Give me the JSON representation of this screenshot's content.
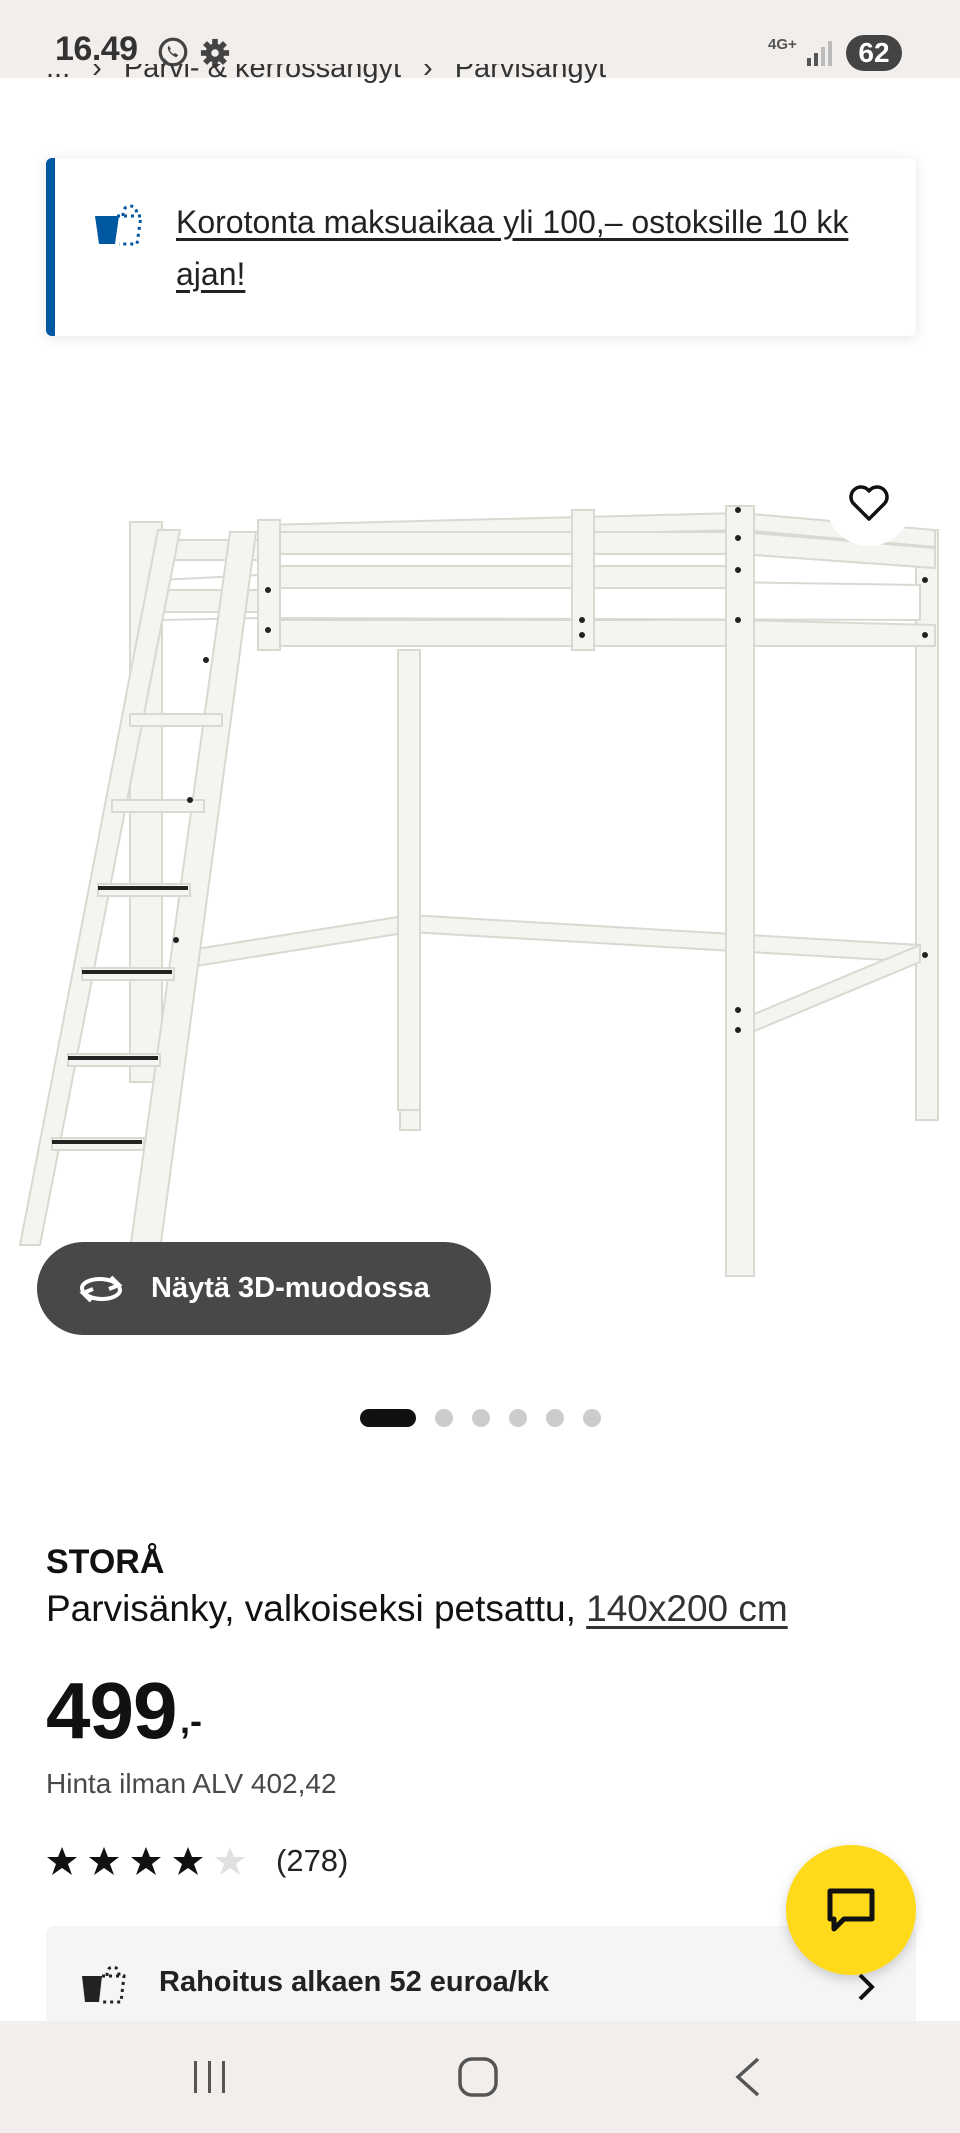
{
  "status_bar": {
    "time": "16.49",
    "network": "4G+",
    "battery": "62"
  },
  "breadcrumb": {
    "items": [
      "...",
      "Parvi- & kerrossängyt",
      "Parvisängyt"
    ],
    "separator": "›"
  },
  "promo": {
    "text": "Korotonta maksuaikaa yli 100,– ostoksille 10 kk ajan!"
  },
  "product": {
    "brand": "STORÅ",
    "description": "Parvisänky, valkoiseksi petsattu,",
    "size": "140x200 cm",
    "price": "499",
    "price_suffix": ",-",
    "vat_text": "Hinta ilman ALV 402,42",
    "rating": 4,
    "rating_max": 5,
    "review_count": "(278)"
  },
  "view_3d_label": "Näytä 3D-muodossa",
  "carousel": {
    "count": 6,
    "active_index": 0
  },
  "financing": {
    "label": "Rahoitus alkaen 52 euroa/kk"
  },
  "colors": {
    "accent_blue": "#0058a3",
    "chat_yellow": "#ffda1a",
    "pill_dark": "#484848"
  },
  "icons": {
    "favorite": "heart-outline-icon",
    "view3d": "rotate-icon",
    "chat": "chat-bubble-icon",
    "financing": "shopping-bag-icon"
  }
}
